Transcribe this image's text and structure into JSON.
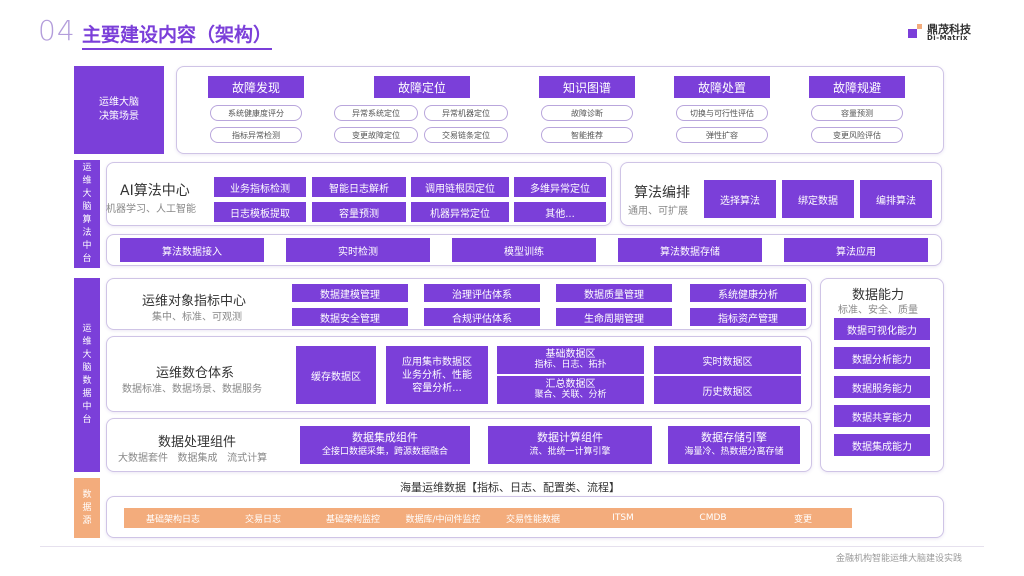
{
  "header": {
    "number": "04",
    "title": "主要建设内容（架构）",
    "logo_cn": "鼎茂科技",
    "logo_en": "Di-Matrix"
  },
  "footer": {
    "text": "金融机构智能运维大脑建设实践"
  },
  "colors": {
    "accent": "#7b3fd9",
    "peach": "#f3ac7c",
    "border": "#cfc4e6"
  },
  "scene": {
    "label": "运维大脑\n决策场景",
    "columns": [
      {
        "title": "故障发现",
        "items": [
          "系统健康度评分",
          "指标异常检测"
        ]
      },
      {
        "title": "故障定位",
        "items": [
          "异常系统定位",
          "异常机器定位",
          "变更故障定位",
          "交易链条定位"
        ]
      },
      {
        "title": "知识图谱",
        "items": [
          "故障诊断",
          "智能推荐"
        ]
      },
      {
        "title": "故障处置",
        "items": [
          "切换与可行性评估",
          "弹性扩容"
        ]
      },
      {
        "title": "故障规避",
        "items": [
          "容量预测",
          "变更风险评估"
        ]
      }
    ]
  },
  "algo_side": "运\n维\n大\n脑\n算\n法\n中\n台",
  "ai_center": {
    "title": "AI算法中心",
    "subtitle": "机器学习、人工智能",
    "items": [
      "业务指标检测",
      "智能日志解析",
      "调用链根因定位",
      "多维异常定位",
      "日志模板提取",
      "容量预测",
      "机器异常定位",
      "其他..."
    ]
  },
  "algo_orch": {
    "title": "算法编排",
    "subtitle": "通用、可扩展",
    "items": [
      "选择算法",
      "绑定数据",
      "编排算法"
    ]
  },
  "algo_flow": [
    "算法数据接入",
    "实时检测",
    "模型训练",
    "算法数据存储",
    "算法应用"
  ],
  "data_side": "运\n维\n大\n脑\n数\n据\n中\n台",
  "object_center": {
    "title": "运维对象指标中心",
    "subtitle": "集中、标准、可观测",
    "items": [
      "数据建模管理",
      "治理评估体系",
      "数据质量管理",
      "系统健康分析",
      "数据安全管理",
      "合规评估体系",
      "生命周期管理",
      "指标资产管理"
    ]
  },
  "warehouse": {
    "title": "运维数仓体系",
    "subtitle": "数据标准、数据场景、数据服务",
    "cache": "缓存数据区",
    "app": "应用集市数据区\n业务分析、性能\n容量分析...",
    "base_title": "基础数据区",
    "base_sub": "指标、日志、拓扑",
    "agg_title": "汇总数据区",
    "agg_sub": "聚合、关联、分析",
    "realtime": "实时数据区",
    "history": "历史数据区"
  },
  "processing": {
    "title": "数据处理组件",
    "subtitle": "大数据套件   数据集成   流式计算",
    "items": [
      {
        "title": "数据集成组件",
        "sub": "全接口数据采集，跨源数据融合"
      },
      {
        "title": "数据计算组件",
        "sub": "流、批统一计算引擎"
      },
      {
        "title": "数据存储引擎",
        "sub": "海量冷、热数据分离存储"
      }
    ]
  },
  "capability": {
    "title": "数据能力",
    "subtitle": "标准、安全、质量",
    "items": [
      "数据可视化能力",
      "数据分析能力",
      "数据服务能力",
      "数据共享能力",
      "数据集成能力"
    ]
  },
  "source": {
    "side": "数\n据\n源",
    "title": "海量运维数据【指标、日志、配置类、流程】",
    "items": [
      "基础架构日志",
      "交易日志",
      "基础架构监控",
      "数据库/中间件监控",
      "交易性能数据",
      "ITSM",
      "CMDB",
      "变更"
    ]
  }
}
